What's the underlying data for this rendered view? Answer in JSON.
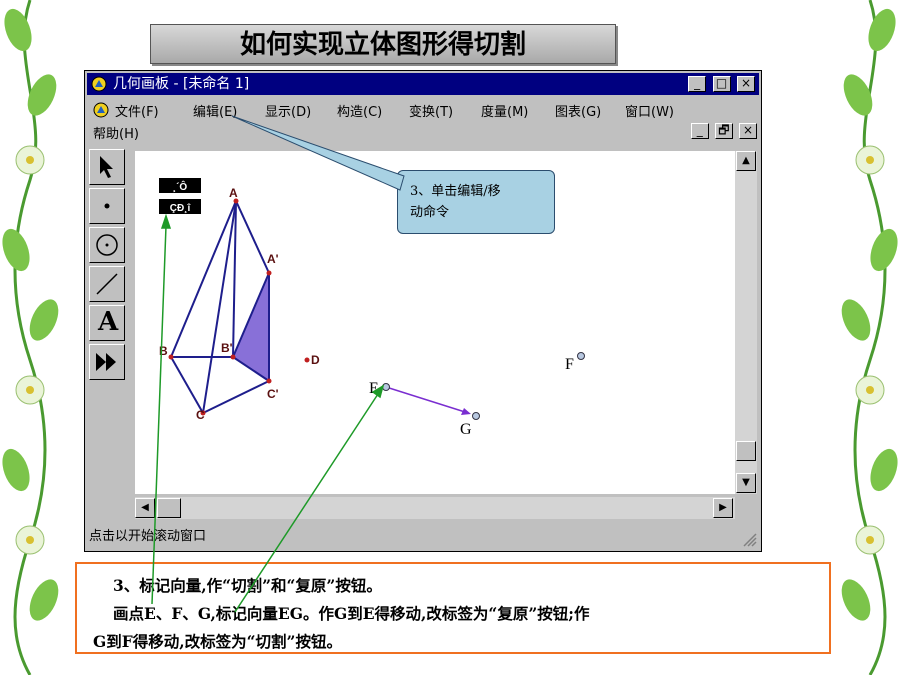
{
  "slide_title": "如何实现立体图形得切割",
  "window": {
    "title": "几何画板 - [未命名 1]",
    "controls": {
      "minimize": "_",
      "maximize": "□",
      "close": "×",
      "restore": "🗗"
    }
  },
  "menu": {
    "row1": [
      "文件(F)",
      "编辑(E)",
      "显示(D)",
      "构造(C)",
      "变换(T)",
      "度量(M)",
      "图表(G)",
      "窗口(W)"
    ],
    "row2": [
      "帮助(H)"
    ]
  },
  "toolbar": {
    "tools": [
      "arrow-tool",
      "point-tool",
      "circle-tool",
      "line-tool",
      "text-tool",
      "script-tool"
    ],
    "text_tool_label": "A"
  },
  "canvas": {
    "buttons": {
      "btn1": "¸´Ô­",
      "btn2": "ÇÐ¸î"
    },
    "point_labels": {
      "A": "A",
      "A_prime": "A'",
      "B": "B",
      "B_prime": "B'",
      "C": "C",
      "C_prime": "C'",
      "D": "D",
      "E": "E",
      "F": "F",
      "G": "G"
    }
  },
  "status": "点击以开始滚动窗口",
  "callout": {
    "line1": "3、单击编辑/移",
    "line2": "动命令"
  },
  "note": {
    "line1": "3、标记向量,作“切割”和“复原”按钮。",
    "line2": "画点E、F、G,标记向量EG。作G到E得移动,改标签为“复原”按钮;作",
    "line3": "G到F得移动,改标签为“切割”按钮。"
  },
  "colors": {
    "title_bar": "#000080",
    "polyhedron": "#1e1e8c",
    "cut_fill": "#8870d8",
    "vector": "#7a2ed0",
    "arrow_green": "#1e9a28",
    "callout_fill": "#a8d1e3",
    "note_border": "#f07020"
  }
}
